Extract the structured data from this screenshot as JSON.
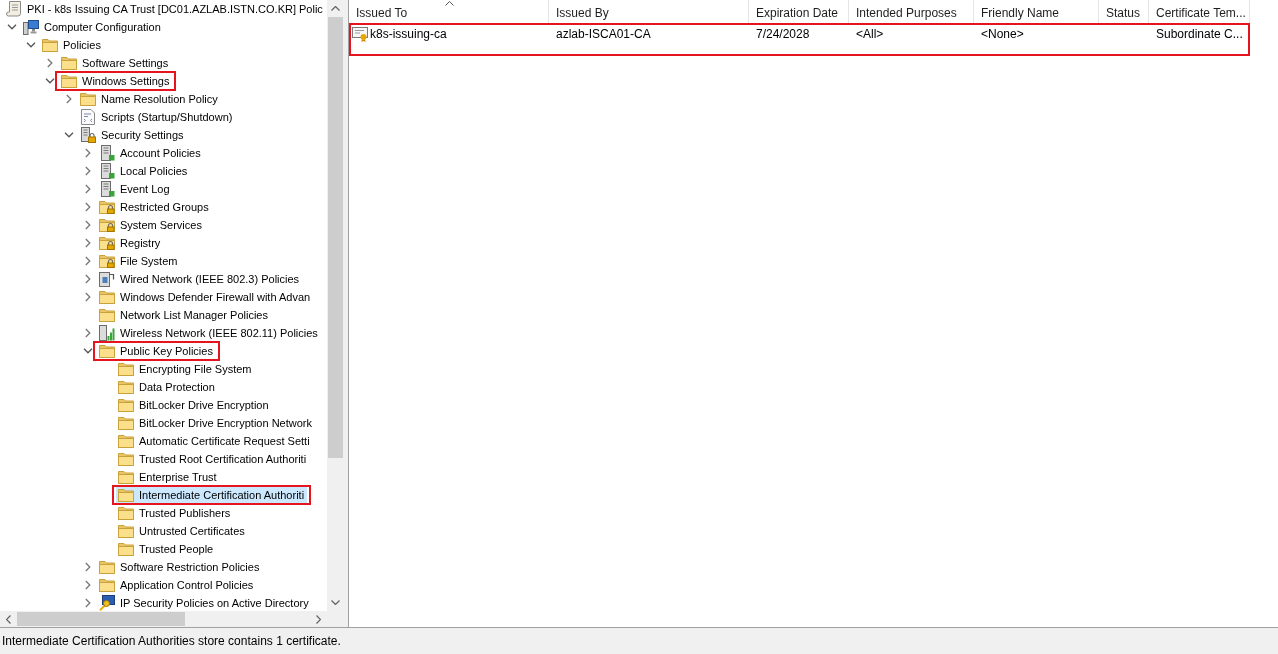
{
  "tree": {
    "items": [
      {
        "label": "PKI - k8s Issuing CA Trust [DC01.AZLAB.ISTN.CO.KR] Polic",
        "kind": "document",
        "selected": false,
        "highlighted": false,
        "children": [
          {
            "label": "Computer Configuration",
            "kind": "computer",
            "expanded": true,
            "selected": false,
            "highlighted": false,
            "children": [
              {
                "label": "Policies",
                "kind": "folder",
                "expanded": true,
                "selected": false,
                "highlighted": false,
                "children": [
                  {
                    "label": "Software Settings",
                    "kind": "folder",
                    "expanded": false,
                    "selected": false,
                    "highlighted": false
                  },
                  {
                    "label": "Windows Settings",
                    "kind": "folder",
                    "expanded": true,
                    "selected": false,
                    "highlighted": true,
                    "children": [
                      {
                        "label": "Name Resolution Policy",
                        "kind": "folder",
                        "expanded": false,
                        "selected": false,
                        "highlighted": false
                      },
                      {
                        "label": "Scripts (Startup/Shutdown)",
                        "kind": "script",
                        "selected": false,
                        "highlighted": false
                      },
                      {
                        "label": "Security Settings",
                        "kind": "secure-server",
                        "expanded": true,
                        "selected": false,
                        "highlighted": false,
                        "children": [
                          {
                            "label": "Account Policies",
                            "kind": "server",
                            "expanded": false,
                            "selected": false,
                            "highlighted": false
                          },
                          {
                            "label": "Local Policies",
                            "kind": "server",
                            "expanded": false,
                            "selected": false,
                            "highlighted": false
                          },
                          {
                            "label": "Event Log",
                            "kind": "server",
                            "expanded": false,
                            "selected": false,
                            "highlighted": false
                          },
                          {
                            "label": "Restricted Groups",
                            "kind": "locked-folder",
                            "expanded": false,
                            "selected": false,
                            "highlighted": false
                          },
                          {
                            "label": "System Services",
                            "kind": "locked-folder",
                            "expanded": false,
                            "selected": false,
                            "highlighted": false
                          },
                          {
                            "label": "Registry",
                            "kind": "locked-folder",
                            "expanded": false,
                            "selected": false,
                            "highlighted": false
                          },
                          {
                            "label": "File System",
                            "kind": "locked-folder",
                            "expanded": false,
                            "selected": false,
                            "highlighted": false
                          },
                          {
                            "label": "Wired Network (IEEE 802.3) Policies",
                            "kind": "wired-network",
                            "expanded": false,
                            "selected": false,
                            "highlighted": false
                          },
                          {
                            "label": "Windows Defender Firewall with Advan",
                            "kind": "folder",
                            "expanded": false,
                            "selected": false,
                            "highlighted": false
                          },
                          {
                            "label": "Network List Manager Policies",
                            "kind": "folder",
                            "selected": false,
                            "highlighted": false
                          },
                          {
                            "label": "Wireless Network (IEEE 802.11) Policies",
                            "kind": "wireless-network",
                            "expanded": false,
                            "selected": false,
                            "highlighted": false
                          },
                          {
                            "label": "Public Key Policies",
                            "kind": "folder",
                            "expanded": true,
                            "selected": false,
                            "highlighted": true,
                            "children": [
                              {
                                "label": "Encrypting File System",
                                "kind": "folder",
                                "selected": false,
                                "highlighted": false
                              },
                              {
                                "label": "Data Protection",
                                "kind": "folder",
                                "selected": false,
                                "highlighted": false
                              },
                              {
                                "label": "BitLocker Drive Encryption",
                                "kind": "folder",
                                "selected": false,
                                "highlighted": false
                              },
                              {
                                "label": "BitLocker Drive Encryption Network",
                                "kind": "folder",
                                "selected": false,
                                "highlighted": false
                              },
                              {
                                "label": "Automatic Certificate Request Setti",
                                "kind": "folder",
                                "selected": false,
                                "highlighted": false
                              },
                              {
                                "label": "Trusted Root Certification Authoriti",
                                "kind": "folder",
                                "selected": false,
                                "highlighted": false
                              },
                              {
                                "label": "Enterprise Trust",
                                "kind": "folder",
                                "selected": false,
                                "highlighted": false
                              },
                              {
                                "label": "Intermediate Certification Authoriti",
                                "kind": "folder",
                                "selected": true,
                                "highlighted": true
                              },
                              {
                                "label": "Trusted Publishers",
                                "kind": "folder",
                                "selected": false,
                                "highlighted": false
                              },
                              {
                                "label": "Untrusted Certificates",
                                "kind": "folder",
                                "selected": false,
                                "highlighted": false
                              },
                              {
                                "label": "Trusted People",
                                "kind": "folder",
                                "selected": false,
                                "highlighted": false
                              }
                            ]
                          },
                          {
                            "label": "Software Restriction Policies",
                            "kind": "folder",
                            "expanded": false,
                            "selected": false,
                            "highlighted": false
                          },
                          {
                            "label": "Application Control Policies",
                            "kind": "folder",
                            "expanded": false,
                            "selected": false,
                            "highlighted": false
                          },
                          {
                            "label": "IP Security Policies on Active Directory",
                            "kind": "computer-key",
                            "expanded": false,
                            "selected": false,
                            "highlighted": false
                          }
                        ]
                      }
                    ]
                  }
                ]
              }
            ]
          }
        ]
      }
    ]
  },
  "table": {
    "columns": [
      {
        "label": "Issued To",
        "sorted": true
      },
      {
        "label": "Issued By",
        "sorted": false
      },
      {
        "label": "Expiration Date",
        "sorted": false
      },
      {
        "label": "Intended Purposes",
        "sorted": false
      },
      {
        "label": "Friendly Name",
        "sorted": false
      },
      {
        "label": "Status",
        "sorted": false
      },
      {
        "label": "Certificate Tem...",
        "sorted": false
      }
    ],
    "rows": [
      {
        "issued_to": "k8s-issuing-ca",
        "issued_by": "azlab-ISCA01-CA",
        "expiration_date": "7/24/2028",
        "intended_purposes": "<All>",
        "friendly_name": "<None>",
        "certificate_template": "Subordinate C...",
        "highlighted": true
      }
    ]
  },
  "status_bar": {
    "text": "Intermediate Certification Authorities store contains 1 certificate."
  }
}
